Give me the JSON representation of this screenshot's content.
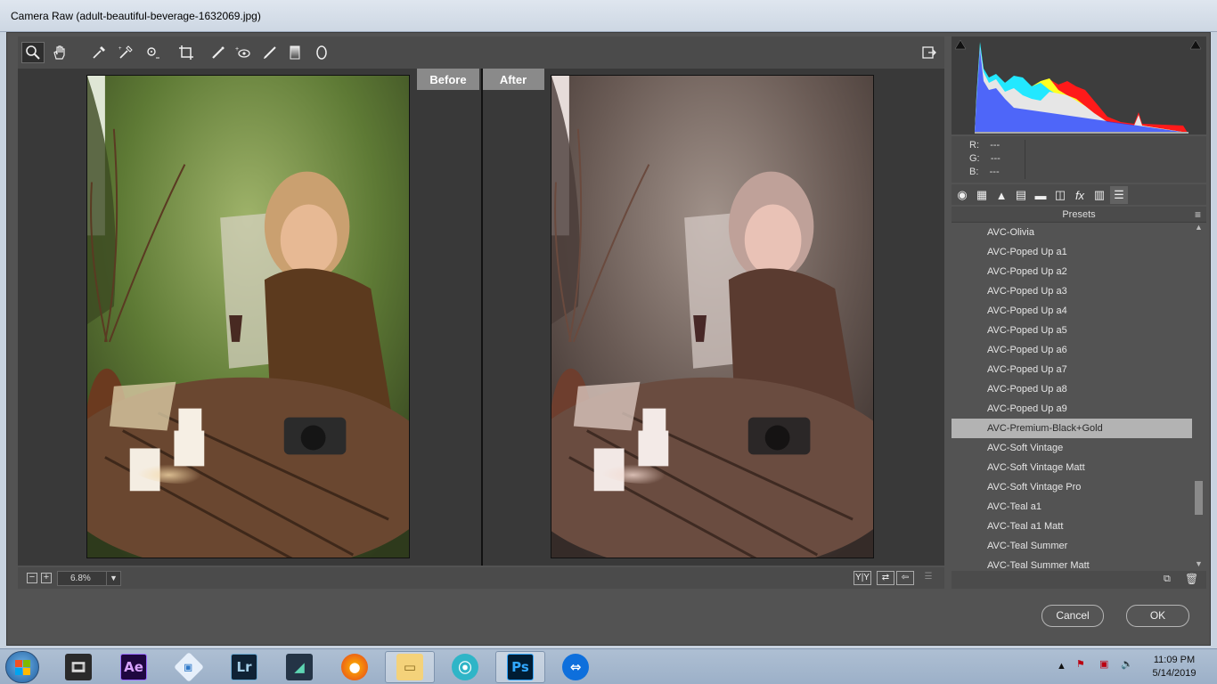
{
  "window": {
    "title": "Camera Raw (adult-beautiful-beverage-1632069.jpg)"
  },
  "toolbar": {
    "tools": [
      "zoom-icon",
      "hand-icon",
      "white-balance-icon",
      "color-sampler-icon",
      "targeted-adjustment-icon",
      "crop-icon",
      "spot-removal-icon",
      "red-eye-icon",
      "adjustment-brush-icon",
      "graduated-filter-icon",
      "radial-filter-icon"
    ],
    "open_preferences": "open-in-photoshop-icon"
  },
  "preview": {
    "before_label": "Before",
    "after_label": "After"
  },
  "zoom": {
    "value": "6.8%"
  },
  "rgb_readout": {
    "r_label": "R:",
    "g_label": "G:",
    "b_label": "B:",
    "r": "---",
    "g": "---",
    "b": "---"
  },
  "presets": {
    "title": "Presets",
    "items": [
      "AVC-Olivia",
      "AVC-Poped Up a1",
      "AVC-Poped Up a2",
      "AVC-Poped Up a3",
      "AVC-Poped Up a4",
      "AVC-Poped Up a5",
      "AVC-Poped Up a6",
      "AVC-Poped Up a7",
      "AVC-Poped Up a8",
      "AVC-Poped Up a9",
      "AVC-Premium-Black+Gold",
      "AVC-Soft Vintage",
      "AVC-Soft Vintage Matt",
      "AVC-Soft Vintage Pro",
      "AVC-Teal a1",
      "AVC-Teal a1 Matt",
      "AVC-Teal Summer",
      "AVC-Teal Summer Matt"
    ],
    "selected_index": 10
  },
  "buttons": {
    "cancel": "Cancel",
    "ok": "OK"
  },
  "taskbar": {
    "apps": [
      "windows-movie-maker-icon",
      "after-effects-icon",
      "app-icon",
      "lightroom-icon",
      "filmora-icon",
      "firefox-icon",
      "file-explorer-icon",
      "screen-recorder-icon",
      "photoshop-icon",
      "teamviewer-icon"
    ],
    "ae_label": "Ae",
    "lr_label": "Lr",
    "ps_label": "Ps",
    "time": "11:09 PM",
    "date": "5/14/2019"
  },
  "colors": {
    "panel": "#535353",
    "selection": "#b3b3b3",
    "accent_ps": "#31a8ff"
  }
}
